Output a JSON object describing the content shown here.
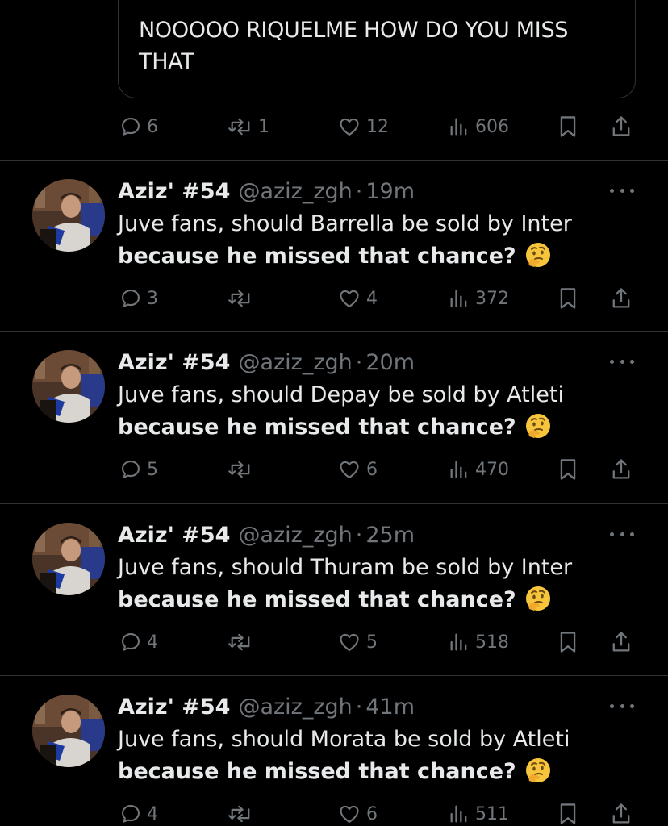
{
  "quoted": {
    "text_line1": "NOOOOO RIQUELME HOW DO YOU MISS",
    "text_line2": "THAT",
    "replies": "6",
    "retweets": "1",
    "likes": "12",
    "views": "606"
  },
  "tweets": [
    {
      "name": "Aziz' #54",
      "handle": "@aziz_zgh",
      "time": "19m",
      "line1": "Juve fans, should Barrella be sold by Inter",
      "line2": "because he missed that chance?",
      "replies": "3",
      "retweets": "",
      "likes": "4",
      "views": "372"
    },
    {
      "name": "Aziz' #54",
      "handle": "@aziz_zgh",
      "time": "20m",
      "line1": "Juve fans, should Depay be sold by Atleti",
      "line2": "because he missed that chance?",
      "replies": "5",
      "retweets": "",
      "likes": "6",
      "views": "470"
    },
    {
      "name": "Aziz' #54",
      "handle": "@aziz_zgh",
      "time": "25m",
      "line1": "Juve fans, should Thuram be sold by Inter",
      "line2": "because he missed that chance?",
      "replies": "4",
      "retweets": "",
      "likes": "5",
      "views": "518"
    },
    {
      "name": "Aziz' #54",
      "handle": "@aziz_zgh",
      "time": "41m",
      "line1": "Juve fans, should Morata be sold by Atleti",
      "line2": "because he missed that chance?",
      "replies": "4",
      "retweets": "",
      "likes": "6",
      "views": "511"
    }
  ],
  "icons": {
    "reply": "reply-icon",
    "retweet": "retweet-icon",
    "like": "heart-icon",
    "views": "views-icon",
    "bookmark": "bookmark-icon",
    "share": "share-icon",
    "more": "more-icon",
    "emoji": "thinking-face-emoji"
  },
  "colors": {
    "background": "#000000",
    "text": "#e7e9ea",
    "secondary": "#71767b",
    "divider": "#2f3336"
  }
}
